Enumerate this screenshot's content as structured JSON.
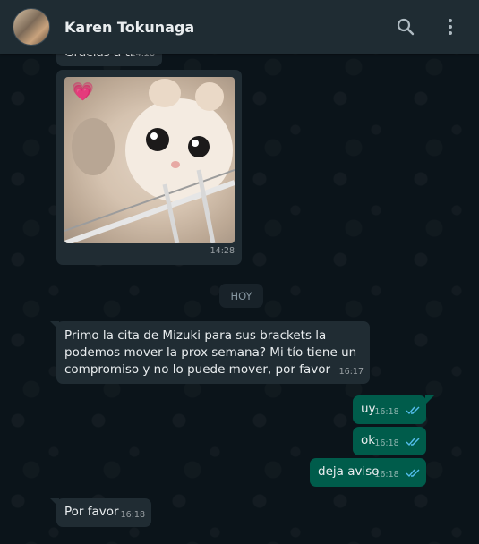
{
  "header": {
    "contact_name": "Karen Tokunaga",
    "avatar_icon": "avatar",
    "search_icon": "search-icon",
    "menu_icon": "menu-icon"
  },
  "messages": {
    "gracias": {
      "text": "Gracias a ti",
      "time": "14:28"
    },
    "image": {
      "time": "14:28",
      "emoji": "💗"
    },
    "date_chip": "HOY",
    "primo": {
      "line1": "Primo la cita de Mizuki para sus brackets la",
      "line2": "podemos mover la prox semana? Mi tío tiene un",
      "line3": "compromiso y no lo puede mover, por favor",
      "time": "16:17"
    },
    "uy": {
      "text": "uy",
      "time": "16:18"
    },
    "ok": {
      "text": "ok",
      "time": "16:18"
    },
    "deja": {
      "text": "deja aviso",
      "time": "16:18"
    },
    "porfavor": {
      "text": "Por favor",
      "time": "16:18"
    }
  },
  "colors": {
    "background": "#0b141a",
    "header": "#1f2c33",
    "incoming": "#202c33",
    "outgoing": "#005c4b",
    "read_ticks": "#53bdeb"
  }
}
